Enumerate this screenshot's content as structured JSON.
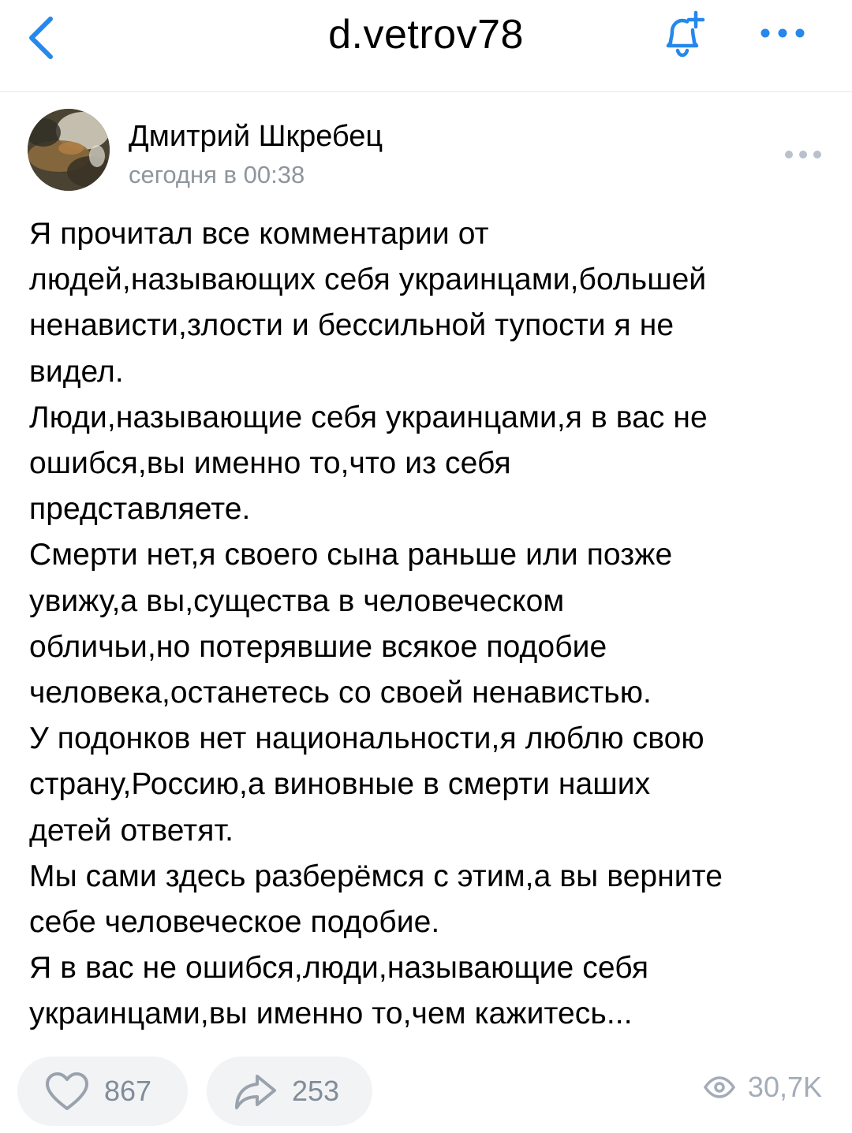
{
  "header": {
    "title": "d.vetrov78"
  },
  "post": {
    "author_name": "Дмитрий Шкребец",
    "time": "сегодня в 00:38",
    "text": "Я прочитал все комментарии от\nлюдей,называющих себя украинцами,большей\nненависти,злости и бессильной тупости я не\nвидел.\nЛюди,называющие себя украинцами,я в вас не\nошибся,вы именно то,что из себя\nпредставляете.\nСмерти нет,я своего сына раньше или позже\nувижу,а вы,существа в человеческом\nобличьи,но потерявшие всякое подобие\nчеловека,останетесь со своей ненавистью.\nУ подонков нет национальности,я люблю свою\nстрану,Россию,а виновные в смерти наших\nдетей ответят.\nМы сами здесь разберёмся с этим,а вы верните\nсебе человеческое подобие.\nЯ в вас не ошибся,люди,называющие себя\nукраинцами,вы именно то,чем кажитесь..."
  },
  "actions": {
    "likes": "867",
    "shares": "253",
    "views": "30,7K"
  },
  "colors": {
    "accent": "#2688eb",
    "secondary_text": "#8f959c",
    "pill_bg": "#f2f3f5"
  },
  "icons": {
    "back": "chevron-left-icon",
    "bell": "bell-plus-icon",
    "more": "more-horizontal-icon",
    "like": "heart-icon",
    "share": "share-arrow-icon",
    "views": "eye-icon"
  }
}
